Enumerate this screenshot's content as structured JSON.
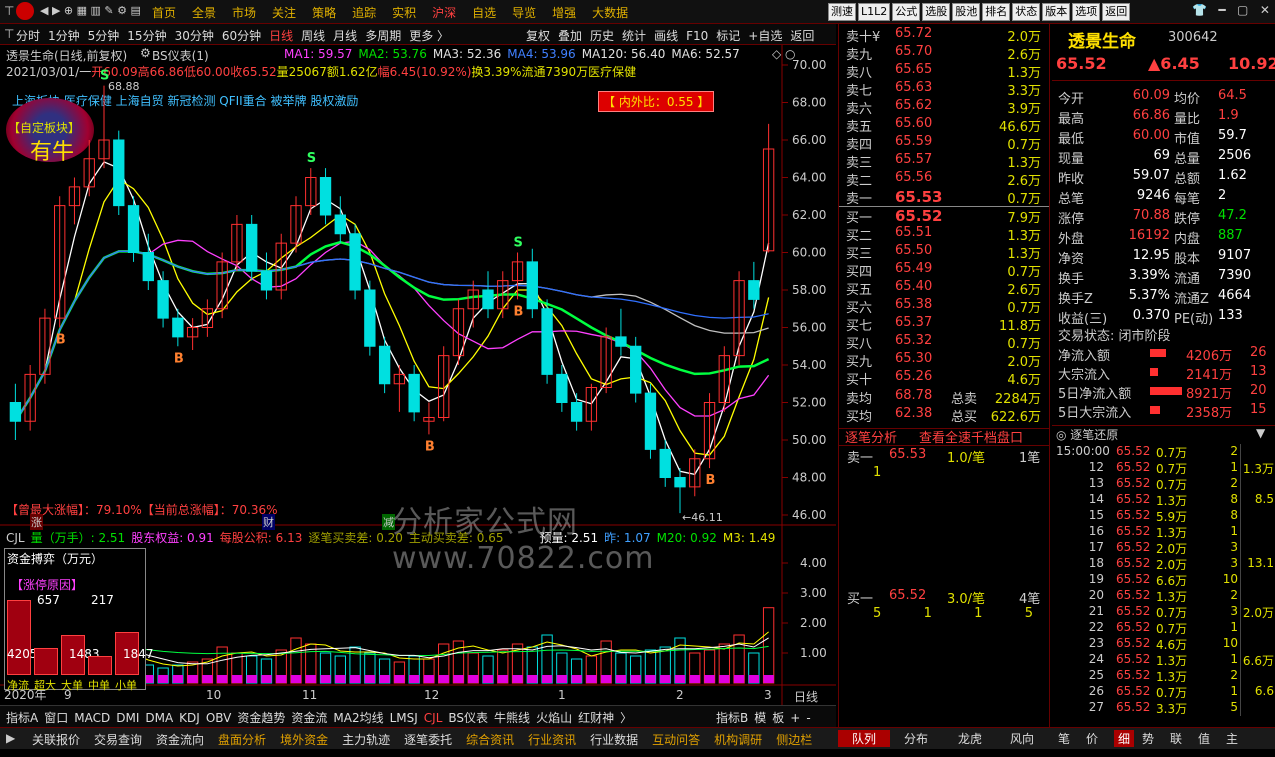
{
  "topbar": {
    "nav": [
      "首页",
      "全景",
      "市场",
      "关注",
      "策略",
      "追踪",
      "实积",
      "沪深",
      "自选",
      "导览",
      "增强",
      "大数据"
    ],
    "active": "沪深",
    "buttons": [
      "测速",
      "L1L2",
      "公式",
      "选股",
      "股池",
      "排名",
      "状态",
      "版本",
      "选项",
      "返回"
    ]
  },
  "period": {
    "items": [
      "分时",
      "1分钟",
      "5分钟",
      "15分钟",
      "30分钟",
      "60分钟",
      "日线",
      "周线",
      "月线",
      "多周期",
      "更多 〉"
    ],
    "active": "日线",
    "tools": [
      "复权",
      "叠加",
      "历史",
      "统计",
      "画线",
      "F10",
      "标记",
      "+自选",
      "返回"
    ]
  },
  "chart_header": {
    "title": "透景生命(日线,前复权)",
    "indicator": "BS仪表(1)",
    "ma": [
      {
        "label": "MA1: 59.57",
        "color": "#ff40ff"
      },
      {
        "label": "MA2: 53.76",
        "color": "#00e000"
      },
      {
        "label": "MA3: 52.36",
        "color": "#e0e0e0"
      },
      {
        "label": "MA4: 53.96",
        "color": "#4080ff"
      },
      {
        "label": "MA120: 56.40",
        "color": "#e0e0e0"
      },
      {
        "label": "MA6: 52.57",
        "color": "#e0e0e0"
      }
    ],
    "line2": {
      "date": "2021/03/01/一",
      "open": "开60.09",
      "high": "高66.86",
      "low": "低60.00",
      "close": "收65.52",
      "vol": "量25067",
      "amt": "额1.62亿",
      "change": "幅6.45(10.92%)",
      "turn": "换3.39%",
      "flow": "流通7390万",
      "sector": "医疗保健"
    },
    "concepts": "上海板块 医疗保健 上海自贸 新冠检测 QFII重合 被举牌 股权激励",
    "ratio": "【 内外比：0.55 】",
    "badge_top": "【自定板块】",
    "badge_main": "有牛"
  },
  "chart_data": {
    "type": "candlestick",
    "ylim": [
      46,
      70
    ],
    "yticks": [
      "70.00",
      "68.00",
      "66.00",
      "64.00",
      "62.00",
      "60.00",
      "58.00",
      "56.00",
      "54.00",
      "52.00",
      "50.00",
      "48.00",
      "46.00"
    ],
    "xticks": [
      "2020年",
      "9",
      "10",
      "11",
      "12",
      "1",
      "2",
      "3"
    ],
    "annotations": {
      "high": "68.88",
      "low": "46.11"
    },
    "candles": [
      [
        52,
        53,
        50,
        51
      ],
      [
        51,
        54,
        50.5,
        53.5
      ],
      [
        53.5,
        57,
        53,
        56.5
      ],
      [
        56.5,
        63,
        56,
        62.5
      ],
      [
        62.5,
        64,
        61.5,
        63.5
      ],
      [
        63.5,
        66,
        63,
        65
      ],
      [
        65,
        68.9,
        64.5,
        66
      ],
      [
        66,
        66.5,
        62,
        62.5
      ],
      [
        62.5,
        63,
        59.5,
        60
      ],
      [
        60,
        61,
        58,
        58.5
      ],
      [
        58.5,
        59,
        56,
        56.5
      ],
      [
        56.5,
        57,
        55,
        55.5
      ],
      [
        55.5,
        56.5,
        54.8,
        56
      ],
      [
        56,
        57.5,
        55.5,
        57
      ],
      [
        57,
        60,
        56.5,
        59.5
      ],
      [
        59.5,
        62,
        59,
        61.5
      ],
      [
        61.5,
        62,
        58.5,
        59
      ],
      [
        59,
        60,
        57.5,
        58
      ],
      [
        58,
        61,
        57.5,
        60.5
      ],
      [
        60.5,
        63,
        60,
        62.5
      ],
      [
        62.5,
        64.5,
        62,
        64
      ],
      [
        64,
        64.5,
        61.5,
        62
      ],
      [
        62,
        63,
        60.5,
        61
      ],
      [
        61,
        61.5,
        57.5,
        58
      ],
      [
        58,
        58.5,
        54.5,
        55
      ],
      [
        55,
        55.5,
        52.5,
        53
      ],
      [
        53,
        54,
        51.5,
        53.5
      ],
      [
        53.5,
        54,
        51,
        51.5
      ],
      [
        51,
        52,
        50.3,
        51.2
      ],
      [
        51.2,
        55,
        51,
        54.5
      ],
      [
        54.5,
        57.5,
        54,
        57
      ],
      [
        57,
        58.5,
        56,
        58
      ],
      [
        58,
        59,
        56.5,
        57
      ],
      [
        57,
        59,
        56.5,
        58.5
      ],
      [
        58.5,
        60,
        57.5,
        59.5
      ],
      [
        59.5,
        60.2,
        56.5,
        57
      ],
      [
        57,
        57.5,
        53,
        53.5
      ],
      [
        53.5,
        54,
        51.5,
        52
      ],
      [
        52,
        52.5,
        50.5,
        51
      ],
      [
        51,
        53,
        50.5,
        52.8
      ],
      [
        52.8,
        56,
        52.5,
        55.5
      ],
      [
        55.5,
        57,
        54.5,
        55
      ],
      [
        55,
        55.5,
        52,
        52.5
      ],
      [
        52.5,
        53,
        49,
        49.5
      ],
      [
        49.5,
        50,
        47.5,
        48
      ],
      [
        48,
        48.5,
        46.1,
        47.5
      ],
      [
        47.5,
        49.5,
        47,
        49
      ],
      [
        49,
        52.5,
        48.5,
        52
      ],
      [
        52,
        55,
        51.5,
        54.5
      ],
      [
        54.5,
        59,
        54,
        58.5
      ],
      [
        58.5,
        59.5,
        57,
        57.5
      ],
      [
        60.09,
        66.86,
        60,
        65.52
      ]
    ],
    "volumes": [
      0.6,
      0.8,
      1.6,
      2.1,
      1.4,
      1.1,
      1.2,
      0.9,
      0.8,
      0.6,
      0.5,
      0.6,
      0.7,
      0.8,
      1.2,
      1.0,
      0.9,
      0.8,
      1.1,
      1.5,
      1.3,
      1.0,
      0.9,
      1.2,
      1.0,
      0.8,
      0.7,
      0.9,
      0.8,
      1.3,
      1.4,
      1.0,
      0.9,
      1.1,
      1.3,
      1.2,
      1.6,
      1.0,
      0.8,
      0.9,
      1.4,
      1.0,
      0.9,
      1.1,
      1.2,
      1.5,
      1.0,
      1.1,
      1.3,
      1.6,
      1.0,
      2.51
    ],
    "vol_ylim": [
      0,
      4.6
    ],
    "vol_yticks": [
      "4.00",
      "3.00",
      "2.00",
      "1.00"
    ]
  },
  "chart_labels": {
    "max_rise": "【曾最大涨幅】：79.10%【当前总涨幅】：70.36%",
    "markers": [
      "涨",
      "财",
      "减"
    ],
    "vol_header": [
      {
        "t": "CJL",
        "c": "#ccc"
      },
      {
        "t": "量（万手）: 2.51",
        "c": "#00e000"
      },
      {
        "t": "股东权益: 0.91",
        "c": "#ff40ff"
      },
      {
        "t": "每股公积: 6.13",
        "c": "#ff4040"
      },
      {
        "t": "逐笔买卖差: 0.20",
        "c": "#a0a000"
      },
      {
        "t": "主动买卖差: 0.65",
        "c": "#a0a000"
      },
      {
        "t": "预量: 2.51",
        "c": "#fff"
      },
      {
        "t": "昨: 1.07",
        "c": "#40a0ff"
      },
      {
        "t": "M20: 0.92",
        "c": "#00e000"
      },
      {
        "t": "M3: 1.49",
        "c": "#e0e000"
      }
    ],
    "watermark": "分析家公式网www.70822.com",
    "right_period": "日线"
  },
  "fund_box": {
    "title": "资金搏弈（万元）",
    "reason": "【涨停原因】",
    "values": [
      {
        "top": "657",
        "bottom": "4205",
        "label": "净流",
        "h": 0.78
      },
      {
        "top": "",
        "bottom": "",
        "label": "超大",
        "h": 0.28
      },
      {
        "top": "217",
        "bottom": "1483",
        "label": "大单",
        "h": 0.42
      },
      {
        "top": "",
        "bottom": "",
        "label": "中单",
        "h": 0.2
      },
      {
        "top": "",
        "bottom": "1847",
        "label": "小单",
        "h": 0.45
      }
    ]
  },
  "orderbook": {
    "sells": [
      {
        "l": "卖十¥",
        "p": "65.72",
        "v": "2.0万"
      },
      {
        "l": "卖九",
        "p": "65.70",
        "v": "2.6万"
      },
      {
        "l": "卖八",
        "p": "65.65",
        "v": "1.3万"
      },
      {
        "l": "卖七",
        "p": "65.63",
        "v": "3.3万"
      },
      {
        "l": "卖六",
        "p": "65.62",
        "v": "3.9万"
      },
      {
        "l": "卖五",
        "p": "65.60",
        "v": "46.6万"
      },
      {
        "l": "卖四",
        "p": "65.59",
        "v": "0.7万"
      },
      {
        "l": "卖三",
        "p": "65.57",
        "v": "1.3万"
      },
      {
        "l": "卖二",
        "p": "65.56",
        "v": "2.6万"
      },
      {
        "l": "卖一",
        "p": "65.53",
        "v": "0.7万"
      }
    ],
    "buys": [
      {
        "l": "买一",
        "p": "65.52",
        "v": "7.9万"
      },
      {
        "l": "买二",
        "p": "65.51",
        "v": "1.3万"
      },
      {
        "l": "买三",
        "p": "65.50",
        "v": "1.3万"
      },
      {
        "l": "买四",
        "p": "65.49",
        "v": "0.7万"
      },
      {
        "l": "买五",
        "p": "65.40",
        "v": "2.6万"
      },
      {
        "l": "买六",
        "p": "65.38",
        "v": "0.7万"
      },
      {
        "l": "买七",
        "p": "65.37",
        "v": "11.8万"
      },
      {
        "l": "买八",
        "p": "65.32",
        "v": "0.7万"
      },
      {
        "l": "买九",
        "p": "65.30",
        "v": "2.0万"
      },
      {
        "l": "买十",
        "p": "65.26",
        "v": "4.6万"
      }
    ],
    "avg": [
      {
        "l": "卖均",
        "p": "68.78",
        "k": "总卖",
        "v": "2284万"
      },
      {
        "l": "买均",
        "p": "62.38",
        "k": "总买",
        "v": "622.6万"
      }
    ],
    "tabs": [
      "逐笔分析",
      "查看全速千档盘口"
    ],
    "sell1": {
      "l": "卖一",
      "p": "65.53",
      "n": "1.0/笔",
      "c": "1笔",
      "sub": [
        "1"
      ]
    },
    "buy1": {
      "l": "买一",
      "p": "65.52",
      "n": "3.0/笔",
      "c": "4笔",
      "sub": [
        "5",
        "1",
        "1",
        "5"
      ]
    }
  },
  "info": {
    "name": "透景生命",
    "code": "300642",
    "price": "65.52",
    "change": "▲6.45",
    "pct": "10.92",
    "rows": [
      {
        "k": "今开",
        "v": "60.09",
        "vc": "red",
        "k2": "均价",
        "v2": "64.5",
        "v2c": "red"
      },
      {
        "k": "最高",
        "v": "66.86",
        "vc": "red",
        "k2": "量比",
        "v2": "1.9",
        "v2c": "red"
      },
      {
        "k": "最低",
        "v": "60.00",
        "vc": "red",
        "k2": "市值",
        "v2": "59.7",
        "v2c": "white"
      },
      {
        "k": "现量",
        "v": "69",
        "vc": "white",
        "k2": "总量",
        "v2": "2506",
        "v2c": "white"
      },
      {
        "k": "昨收",
        "v": "59.07",
        "vc": "white",
        "k2": "总额",
        "v2": "1.62",
        "v2c": "white"
      },
      {
        "k": "总笔",
        "v": "9246",
        "vc": "white",
        "k2": "每笔",
        "v2": "2",
        "v2c": "white"
      },
      {
        "k": "涨停",
        "v": "70.88",
        "vc": "red",
        "k2": "跌停",
        "v2": "47.2",
        "v2c": "green"
      },
      {
        "k": "外盘",
        "v": "16192",
        "vc": "red",
        "k2": "内盘",
        "v2": "887",
        "v2c": "green"
      },
      {
        "k": "净资",
        "v": "12.95",
        "vc": "white",
        "k2": "股本",
        "v2": "9107",
        "v2c": "white"
      },
      {
        "k": "换手",
        "v": "3.39%",
        "vc": "white",
        "k2": "流通",
        "v2": "7390",
        "v2c": "white"
      },
      {
        "k": "换手Z",
        "v": "5.37%",
        "vc": "white",
        "k2": "流通Z",
        "v2": "4664",
        "v2c": "white"
      },
      {
        "k": "收益(三)",
        "v": "0.370",
        "vc": "white",
        "k2": "PE(动)",
        "v2": "133",
        "v2c": "white"
      }
    ],
    "status": "交易状态: 闭市阶段",
    "flows": [
      {
        "k": "净流入额",
        "v": "4206万",
        "v2": "26",
        "w": 0.5
      },
      {
        "k": "大宗流入",
        "v": "2141万",
        "v2": "13",
        "w": 0.25
      },
      {
        "k": "5日净流入额",
        "v": "8921万",
        "v2": "20",
        "w": 1
      },
      {
        "k": "5日大宗流入",
        "v": "2358万",
        "v2": "15",
        "w": 0.3
      }
    ],
    "ticks_title": "逐笔还原",
    "ticks": [
      {
        "t": "15:00:00",
        "p": "65.52",
        "v": "0.7万",
        "r": "2",
        "r2": ""
      },
      {
        "t": "12",
        "p": "65.52",
        "v": "0.7万",
        "r": "1",
        "r2": "1.3万"
      },
      {
        "t": "13",
        "p": "65.52",
        "v": "0.7万",
        "r": "2",
        "r2": ""
      },
      {
        "t": "14",
        "p": "65.52",
        "v": "1.3万",
        "r": "8",
        "r2": "8.5"
      },
      {
        "t": "15",
        "p": "65.52",
        "v": "5.9万",
        "r": "8",
        "r2": ""
      },
      {
        "t": "16",
        "p": "65.52",
        "v": "1.3万",
        "r": "1",
        "r2": ""
      },
      {
        "t": "17",
        "p": "65.52",
        "v": "2.0万",
        "r": "3",
        "r2": ""
      },
      {
        "t": "18",
        "p": "65.52",
        "v": "2.0万",
        "r": "3",
        "r2": "13.1"
      },
      {
        "t": "19",
        "p": "65.52",
        "v": "6.6万",
        "r": "10",
        "r2": ""
      },
      {
        "t": "20",
        "p": "65.52",
        "v": "1.3万",
        "r": "2",
        "r2": ""
      },
      {
        "t": "21",
        "p": "65.52",
        "v": "0.7万",
        "r": "3",
        "r2": "2.0万"
      },
      {
        "t": "22",
        "p": "65.52",
        "v": "0.7万",
        "r": "1",
        "r2": ""
      },
      {
        "t": "23",
        "p": "65.52",
        "v": "4.6万",
        "r": "10",
        "r2": ""
      },
      {
        "t": "24",
        "p": "65.52",
        "v": "1.3万",
        "r": "1",
        "r2": "6.6万"
      },
      {
        "t": "25",
        "p": "65.52",
        "v": "1.3万",
        "r": "2",
        "r2": ""
      },
      {
        "t": "26",
        "p": "65.52",
        "v": "0.7万",
        "r": "1",
        "r2": "6.6"
      },
      {
        "t": "27",
        "p": "65.52",
        "v": "3.3万",
        "r": "5",
        "r2": ""
      }
    ]
  },
  "bottom_tabs": [
    "指标A",
    "窗口",
    "MACD",
    "DMI",
    "DMA",
    "KDJ",
    "OBV",
    "资金趋势",
    "资金流",
    "MA2均线",
    "LMSJ",
    "CJL",
    "BS仪表",
    "牛熊线",
    "火焰山",
    "红财神",
    "〉"
  ],
  "bottom_active": "CJL",
  "bottom_right": [
    "指标B",
    "模",
    "板",
    "+",
    "-"
  ],
  "statusbar": [
    {
      "t": "关联报价",
      "o": false
    },
    {
      "t": "交易查询",
      "o": false
    },
    {
      "t": "资金流向",
      "o": false
    },
    {
      "t": "盘面分析",
      "o": true
    },
    {
      "t": "境外资金",
      "o": true
    },
    {
      "t": "主力轨迹",
      "o": false
    },
    {
      "t": "逐笔委托",
      "o": false
    },
    {
      "t": "综合资讯",
      "o": true
    },
    {
      "t": "行业资讯",
      "o": true
    },
    {
      "t": "行业数据",
      "o": false
    },
    {
      "t": "互动问答",
      "o": true
    },
    {
      "t": "机构调研",
      "o": true
    },
    {
      "t": "侧边栏",
      "o": true
    }
  ],
  "right_status": [
    "队列",
    "分布",
    "龙虎",
    "风向",
    "笔",
    "价",
    "细",
    "势",
    "联",
    "值",
    "主"
  ]
}
